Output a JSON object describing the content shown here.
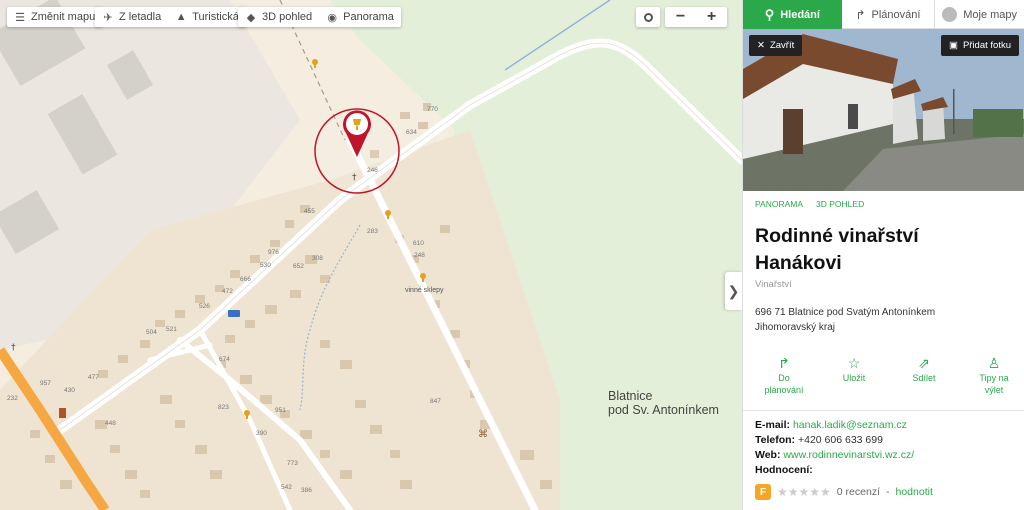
{
  "map": {
    "toolbar": {
      "change_map": "Změnit mapu",
      "aerial": "Z letadla",
      "tourist": "Turistická",
      "view_3d": "3D pohled",
      "panorama": "Panorama"
    },
    "zoom_out": "−",
    "zoom_in": "+",
    "collapse": "❯",
    "place_label_line1": "Blatnice",
    "place_label_line2": "pod Sv. Antonínkem",
    "cellars_label": "vinné sklepy",
    "house_numbers": [
      "770",
      "634",
      "246",
      "455",
      "283",
      "976",
      "666",
      "530",
      "652",
      "308",
      "610",
      "248",
      "472",
      "526",
      "521",
      "504",
      "674",
      "477",
      "430",
      "957",
      "232",
      "448",
      "823",
      "951",
      "847",
      "390",
      "773",
      "542",
      "386"
    ]
  },
  "panel": {
    "tabs": {
      "search": "Hledání",
      "planning": "Plánování",
      "my_maps": "Moje mapy"
    },
    "close": "Zavřít",
    "add_photo": "Přidat fotku",
    "links": {
      "panorama": "PANORAMA",
      "view_3d": "3D POHLED"
    },
    "title_line1": "Rodinné vinařství",
    "title_line2": "Hanákovi",
    "category": "Vinařství",
    "address_line1": "696 71  Blatnice pod Svatým Antonínkem",
    "address_line2": "Jihomoravský kraj",
    "actions": {
      "plan_line1": "Do",
      "plan_line2": "plánování",
      "save": "Uložit",
      "share": "Sdílet",
      "trip_line1": "Tipy na",
      "trip_line2": "výlet"
    },
    "contacts": {
      "email_label": "E-mail:",
      "email": "hanak.ladik@seznam.cz",
      "phone_label": "Telefon:",
      "phone": "+420 606 633 699",
      "web_label": "Web:",
      "web": "www.rodinnevinarstvi.wz.cz/",
      "rating_label": "Hodnocení:"
    },
    "rating": {
      "stars": 0,
      "reviews": "0 recenzí",
      "separator": " - ",
      "rate": "hodnotit"
    }
  },
  "colors": {
    "accent": "#2aa84a",
    "pin": "#c0142a",
    "road_main": "#f5a742"
  }
}
